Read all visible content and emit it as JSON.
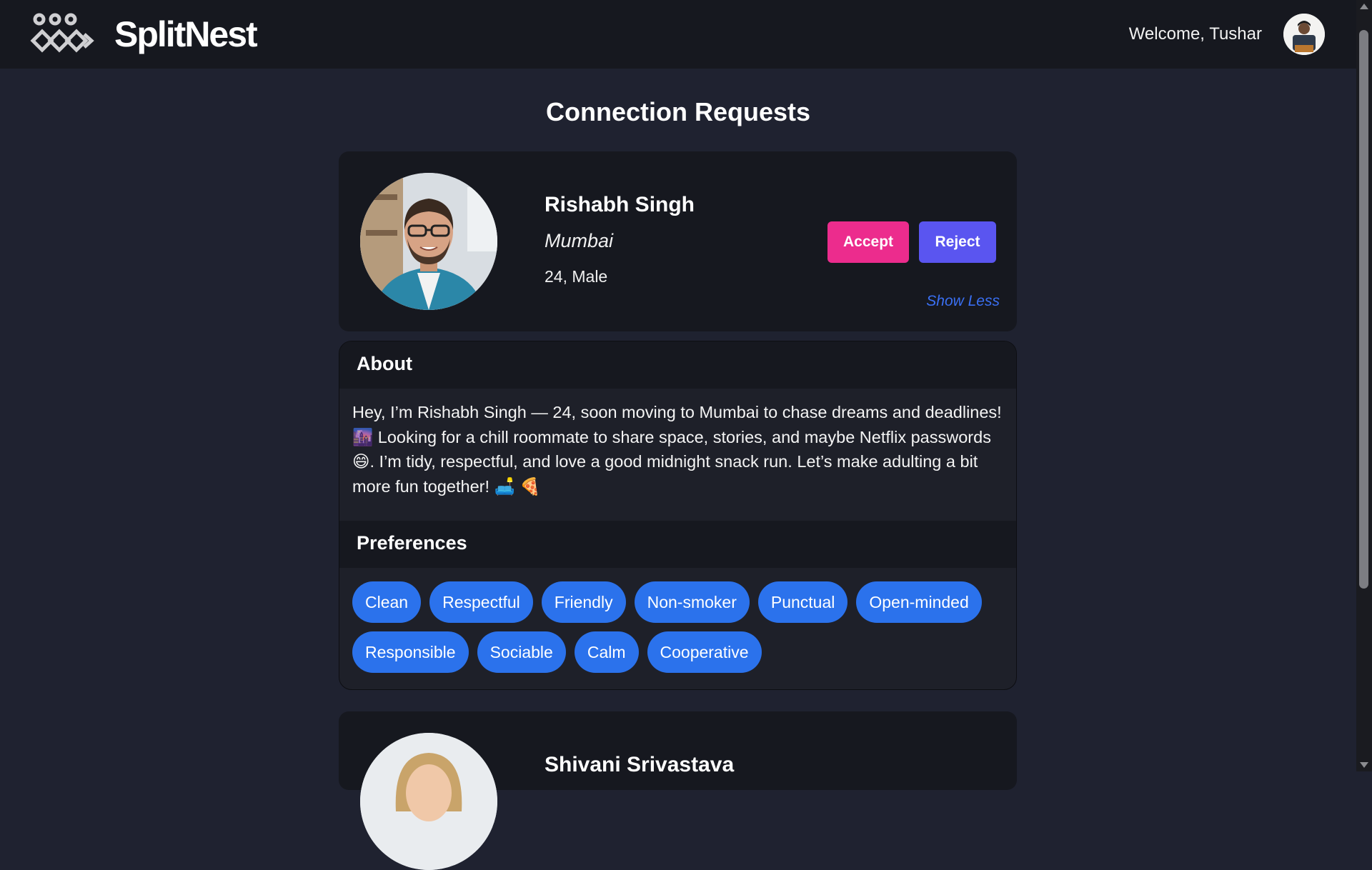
{
  "app": {
    "brand_name": "SplitNest",
    "welcome_text": "Welcome, Tushar"
  },
  "page": {
    "title": "Connection Requests"
  },
  "requests": [
    {
      "name": "Rishabh Singh",
      "city": "Mumbai",
      "age_gender": "24, Male",
      "accept_label": "Accept",
      "reject_label": "Reject",
      "toggle_label": "Show Less",
      "about_heading": "About",
      "about_text": "Hey, I’m Rishabh Singh — 24, soon moving to Mumbai to chase dreams and deadlines! 🌆 Looking for a chill roommate to share space, stories, and maybe Netflix passwords 😄. I’m tidy, respectful, and love a good midnight snack run. Let’s make adulting a bit more fun together! 🛋️ 🍕",
      "preferences_heading": "Preferences",
      "preferences": [
        "Clean",
        "Respectful",
        "Friendly",
        "Non-smoker",
        "Punctual",
        "Open-minded",
        "Responsible",
        "Sociable",
        "Calm",
        "Cooperative"
      ]
    },
    {
      "name": "Shivani Srivastava"
    }
  ],
  "colors": {
    "background": "#1f2230",
    "card": "#16181f",
    "accept": "#ec2c8d",
    "reject": "#5a55f0",
    "tag": "#2b72ec",
    "link": "#3a6ff2"
  }
}
